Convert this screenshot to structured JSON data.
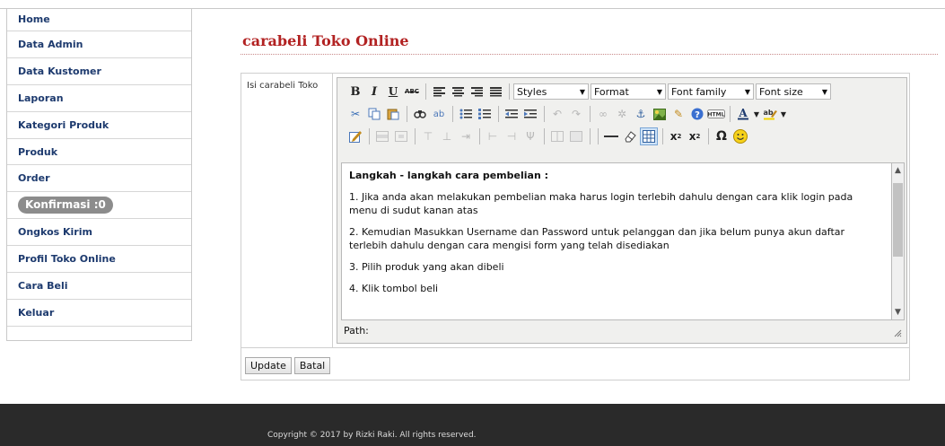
{
  "sidebar": {
    "items": [
      {
        "label": "Home"
      },
      {
        "label": "Data Admin"
      },
      {
        "label": "Data Kustomer"
      },
      {
        "label": "Laporan"
      },
      {
        "label": "Kategori Produk"
      },
      {
        "label": "Produk"
      },
      {
        "label": "Order"
      },
      {
        "label": "Konfirmasi :0"
      },
      {
        "label": "Ongkos Kirim"
      },
      {
        "label": "Profil Toko Online"
      },
      {
        "label": "Cara Beli"
      },
      {
        "label": "Keluar"
      }
    ]
  },
  "main": {
    "title": "carabeli Toko Online",
    "field_label": "Isi carabeli Toko"
  },
  "editor": {
    "selects": {
      "styles": "Styles",
      "format": "Format",
      "font_family": "Font family",
      "font_size": "Font size"
    },
    "content": [
      "Langkah - langkah cara pembelian :",
      "1. Jika anda akan melakukan pembelian maka harus login terlebih dahulu dengan cara klik login pada menu di sudut kanan atas",
      "2. Kemudian Masukkan Username dan Password untuk pelanggan dan jika belum punya akun daftar terlebih dahulu dengan cara mengisi form yang telah disediakan",
      "3. Pilih produk yang akan dibeli",
      "4. Klik tombol beli"
    ],
    "path_label": "Path:"
  },
  "buttons": {
    "update": "Update",
    "cancel": "Batal"
  },
  "footer": {
    "copyright": "Copyright © 2017 by Rizki Raki. All rights reserved."
  },
  "colors": {
    "title": "#b22222",
    "nav_text": "#1d3a6e",
    "badge": "#8c8c8c",
    "footer_bg": "#2a2a2a"
  }
}
